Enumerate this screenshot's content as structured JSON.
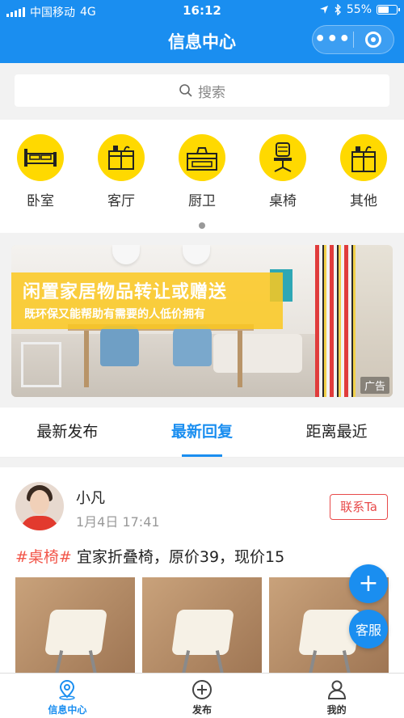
{
  "status_bar": {
    "carrier": "中国移动",
    "network": "4G",
    "time": "16:12",
    "battery": "55%"
  },
  "nav": {
    "title": "信息中心",
    "more_icon": "more-dots-icon",
    "close_icon": "target-circle-icon"
  },
  "search": {
    "placeholder": "搜索"
  },
  "categories": [
    {
      "label": "卧室",
      "icon": "bed-icon"
    },
    {
      "label": "客厅",
      "icon": "cabinet-icon"
    },
    {
      "label": "厨卫",
      "icon": "kitchen-icon"
    },
    {
      "label": "桌椅",
      "icon": "office-chair-icon"
    },
    {
      "label": "其他",
      "icon": "cupboard-icon"
    }
  ],
  "banner": {
    "title": "闲置家居物品转让或赠送",
    "subtitle": "既环保又能帮助有需要的人低价拥有",
    "ad_label": "广告"
  },
  "tabs": [
    {
      "label": "最新发布",
      "active": false
    },
    {
      "label": "最新回复",
      "active": true
    },
    {
      "label": "距离最近",
      "active": false
    }
  ],
  "post": {
    "username": "小凡",
    "time": "1月4日 17:41",
    "contact_label": "联系Ta",
    "tag": "#桌椅#",
    "text": " 宜家折叠椅，原价39，现价15"
  },
  "fab": {
    "add": "+",
    "service": "客服"
  },
  "bottom_nav": [
    {
      "label": "信息中心",
      "active": true,
      "icon": "location-pin-icon"
    },
    {
      "label": "发布",
      "active": false,
      "icon": "plus-circle-icon"
    },
    {
      "label": "我的",
      "active": false,
      "icon": "user-icon"
    }
  ],
  "colors": {
    "primary": "#1a8ef0",
    "category_yellow": "#ffd900",
    "tag_red": "#f2564a"
  }
}
